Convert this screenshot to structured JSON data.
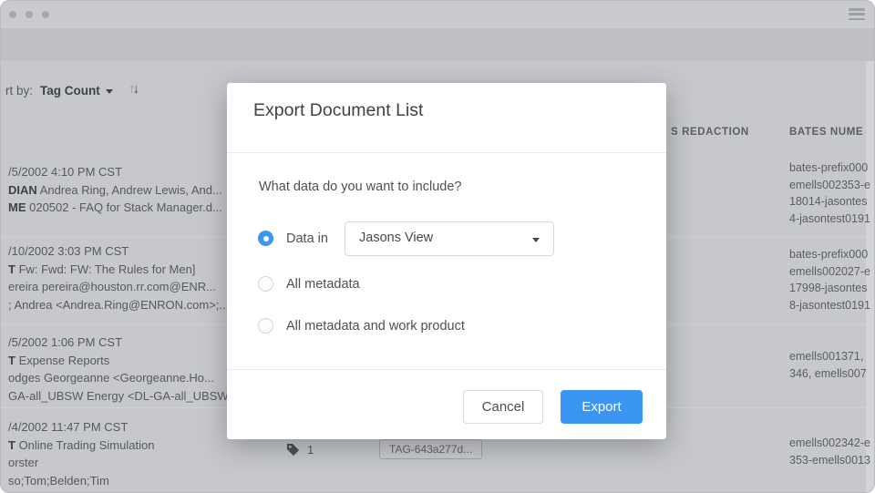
{
  "titlebar": {
    "menu_icon": "hamburger"
  },
  "toolbar": {
    "sort_by_label": "rt by:",
    "sort_value": "Tag Count",
    "sort_asc": "↑",
    "sort_desc": "↓"
  },
  "list": {
    "columns": {
      "redaction": "S REDACTION",
      "bates": "BATES NUME"
    },
    "rows": [
      {
        "lines": [
          {
            "b": "",
            "t": "/5/2002 4:10 PM CST"
          },
          {
            "b": "DIAN",
            "t": " Andrea Ring, Andrew Lewis, And..."
          },
          {
            "b": "ME",
            "t": " 020502 - FAQ for Stack Manager.d..."
          }
        ],
        "bates": [
          "bates-prefix000",
          "emells002353-e",
          "18014-jasontes",
          "4-jasontest0191"
        ]
      },
      {
        "lines": [
          {
            "b": "",
            "t": "/10/2002 3:03 PM CST"
          },
          {
            "b": "T",
            "t": " Fw: Fwd: FW: The Rules for Men]"
          },
          {
            "b": "",
            "t": "ereira pereira@houston.rr.com@ENR..."
          },
          {
            "b": "",
            "t": "; Andrea <Andrea.Ring@ENRON.com>;..."
          }
        ],
        "bates": [
          "bates-prefix000",
          "emells002027-e",
          "17998-jasontes",
          "8-jasontest0191"
        ]
      },
      {
        "lines": [
          {
            "b": "",
            "t": "/5/2002 1:06 PM CST"
          },
          {
            "b": "T",
            "t": " Expense Reports"
          },
          {
            "b": "",
            "t": "odges Georgeanne <Georgeanne.Ho..."
          },
          {
            "b": "",
            "t": "GA-all_UBSW Energy <DL-GA-all_UBSW..."
          }
        ],
        "bates": [
          "emells001371,",
          "346, emells007",
          "",
          ""
        ]
      },
      {
        "lines": [
          {
            "b": "",
            "t": "/4/2002 11:47 PM CST"
          },
          {
            "b": "T",
            "t": " Online Trading Simulation"
          },
          {
            "b": "",
            "t": "orster"
          },
          {
            "b": "",
            "t": "so;Tom;Belden;Tim"
          }
        ],
        "bates": [
          "emells002342-e",
          "353-emells0013",
          "",
          ""
        ],
        "tags": {
          "count": "1",
          "chip": "TAG-643a277d..."
        }
      }
    ]
  },
  "modal": {
    "title": "Export Document List",
    "question": "What data do you want to include?",
    "options": [
      {
        "label": "Data in"
      },
      {
        "label": "All metadata"
      },
      {
        "label": "All metadata and work product"
      }
    ],
    "view_dropdown": {
      "value": "Jasons View"
    },
    "cancel_label": "Cancel",
    "export_label": "Export"
  },
  "colors": {
    "accent_blue": "#3b96f2",
    "window_gray": "#c6c8cb"
  }
}
